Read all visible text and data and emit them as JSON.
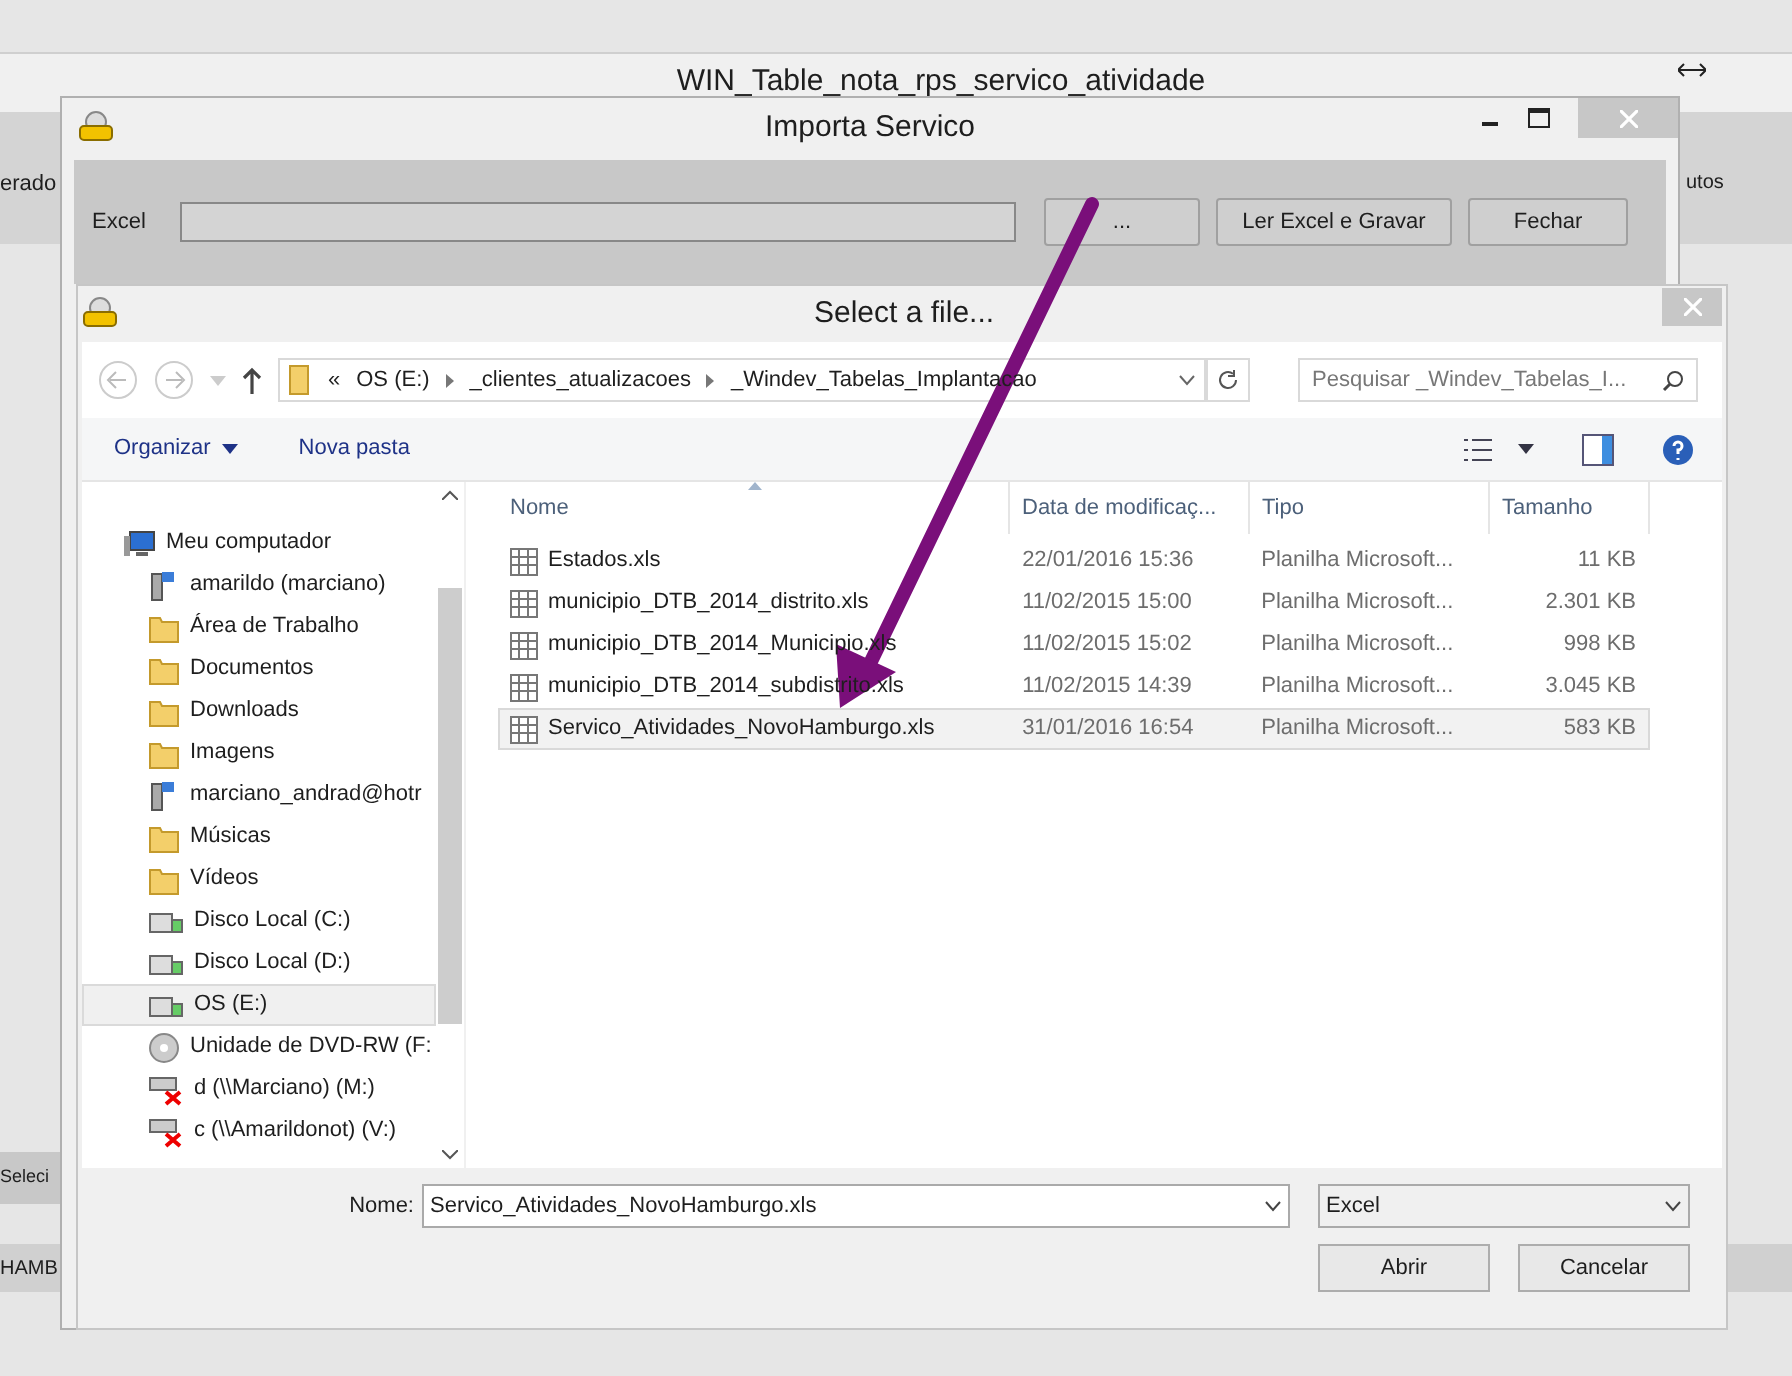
{
  "main_window": {
    "title": "WIN_Table_nota_rps_servico_atividade",
    "left_fragment": "erado",
    "right_fragment": "utos",
    "bottom_fragments": [
      "Seleci",
      "HAMB"
    ]
  },
  "import_window": {
    "title": "Importa Servico",
    "excel_label": "Excel",
    "buttons": [
      "...",
      "Ler Excel e Gravar",
      "Fechar"
    ]
  },
  "file_dialog": {
    "title": "Select a file...",
    "breadcrumb_prefix": "«",
    "breadcrumb": [
      "OS (E:)",
      "_clientes_atualizacoes",
      "_Windev_Tabelas_Implantacao"
    ],
    "search": {
      "placeholder": "Pesquisar _Windev_Tabelas_I..."
    },
    "toolbar": [
      {
        "label": "Organizar",
        "dropdown": true
      },
      {
        "label": "Nova pasta",
        "dropdown": false
      }
    ],
    "nav": [
      {
        "label": "Meu computador",
        "kind": "computer",
        "selected": false,
        "children": [
          {
            "label": "amarildo (marciano)",
            "kind": "network",
            "selected": false
          },
          {
            "label": "Área de Trabalho",
            "kind": "folder",
            "selected": false
          },
          {
            "label": "Documentos",
            "kind": "folder",
            "selected": false
          },
          {
            "label": "Downloads",
            "kind": "folder",
            "selected": false
          },
          {
            "label": "Imagens",
            "kind": "folder",
            "selected": false
          },
          {
            "label": "marciano_andrad@hotr",
            "kind": "network",
            "selected": false
          },
          {
            "label": "Músicas",
            "kind": "folder",
            "selected": false
          },
          {
            "label": "Vídeos",
            "kind": "folder",
            "selected": false
          },
          {
            "label": "Disco Local (C:)",
            "kind": "drive",
            "selected": false
          },
          {
            "label": "Disco Local (D:)",
            "kind": "drive",
            "selected": false
          },
          {
            "label": "OS (E:)",
            "kind": "drive",
            "selected": true
          },
          {
            "label": "Unidade de DVD-RW (F:",
            "kind": "dvd",
            "selected": false
          },
          {
            "label": "d (\\\\Marciano) (M:)",
            "kind": "netdrive",
            "selected": false
          },
          {
            "label": "c (\\\\Amarildonot) (V:)",
            "kind": "netdrive",
            "selected": false
          }
        ]
      }
    ],
    "columns": [
      "Nome",
      "Data de modificaç...",
      "Tipo",
      "Tamanho"
    ],
    "rows": [
      {
        "name": "Estados.xls",
        "date": "22/01/2016 15:36",
        "type": "Planilha Microsoft...",
        "size": "11 KB",
        "selected": false
      },
      {
        "name": "municipio_DTB_2014_distrito.xls",
        "date": "11/02/2015 15:00",
        "type": "Planilha Microsoft...",
        "size": "2.301 KB",
        "selected": false
      },
      {
        "name": "municipio_DTB_2014_Municipio.xls",
        "date": "11/02/2015 15:02",
        "type": "Planilha Microsoft...",
        "size": "998 KB",
        "selected": false
      },
      {
        "name": "municipio_DTB_2014_subdistrito.xls",
        "date": "11/02/2015 14:39",
        "type": "Planilha Microsoft...",
        "size": "3.045 KB",
        "selected": false
      },
      {
        "name": "Servico_Atividades_NovoHamburgo.xls",
        "date": "31/01/2016 16:54",
        "type": "Planilha Microsoft...",
        "size": "583 KB",
        "selected": true
      }
    ],
    "name_label": "Nome:",
    "name_value": "Servico_Atividades_NovoHamburgo.xls",
    "file_type": "Excel",
    "buttons": [
      "Abrir",
      "Cancelar"
    ]
  }
}
